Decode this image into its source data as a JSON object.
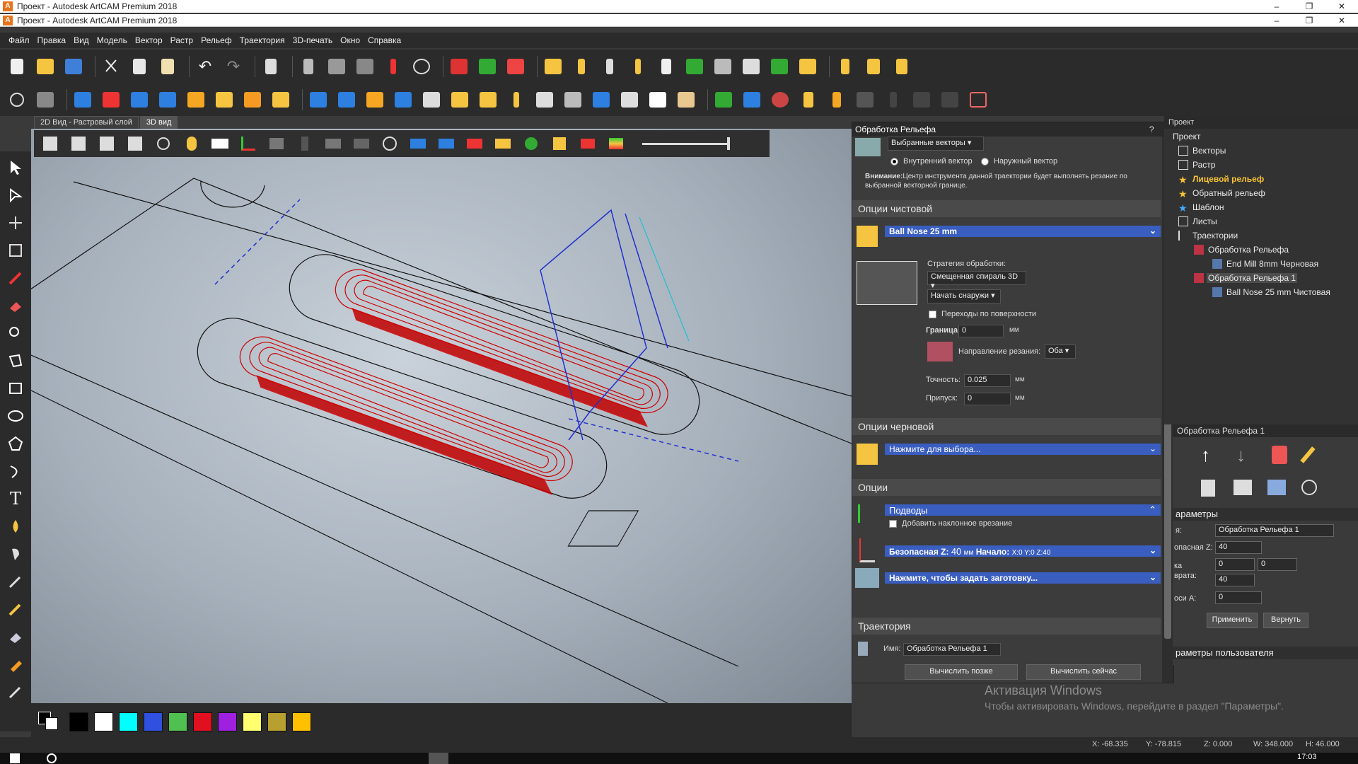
{
  "window": {
    "title_back": "Проект - Autodesk ArtCAM Premium 2018",
    "title_front": "Проект - Autodesk ArtCAM Premium 2018",
    "minimize": "–",
    "restore": "❐",
    "close": "✕"
  },
  "menu": [
    "Файл",
    "Правка",
    "Вид",
    "Модель",
    "Вектор",
    "Растр",
    "Рельеф",
    "Траектория",
    "3D-печать",
    "Окно",
    "Справка"
  ],
  "view_tabs": {
    "tab_2d": "2D Вид - Растровый слой",
    "tab_3d": "3D вид"
  },
  "palette": {
    "colors": [
      "#000000",
      "#ffffff",
      "#00ffff",
      "#3050e0",
      "#50c050",
      "#e01020",
      "#a020e0",
      "#ffff70",
      "#b8a030",
      "#ffc000"
    ]
  },
  "status": {
    "x": "X: -68.335",
    "y": "Y: -78.815",
    "z": "Z: 0.000",
    "w": "W: 348.000",
    "h": "H: 46.000",
    "clock": "17:03"
  },
  "watermark": {
    "line1": "Активация Windows",
    "line2": "Чтобы активировать Windows, перейдите в раздел \"Параметры\"."
  },
  "dialog": {
    "title": "Обработка Рельефа",
    "help": "?",
    "close": "✕",
    "vector_select": "Выбранные векторы",
    "radio_inner": "Внутренний вектор",
    "radio_outer": "Наружный вектор",
    "warning_bold": "Внимание:",
    "warning_text": "Центр инструмента данной траектории будет выполнять резание по выбранной векторной границе.",
    "finish_section": "Опции чистовой",
    "finish_tool": "Ball Nose 25 mm",
    "strategy_label": "Стратегия обработки:",
    "strategy_value": "Смещенная спираль 3D",
    "start_value": "Начать снаружи",
    "surface_transitions": "Переходы по поверхности",
    "boundary_label": "Граница",
    "boundary_value": "0",
    "boundary_unit": "мм",
    "cut_dir_label": "Направление резания:",
    "cut_dir_value": "Оба",
    "tolerance_label": "Точность:",
    "tolerance_value": "0.025",
    "tolerance_unit": "мм",
    "allowance_label": "Припуск:",
    "allowance_value": "0",
    "allowance_unit": "мм",
    "rough_section": "Опции черновой",
    "rough_tool": "Нажмите для выбора...",
    "options_section": "Опции",
    "leads_bar": "Подводы",
    "ramp_label": "Добавить наклонное врезание",
    "safez_bar_label": "Безопасная Z:",
    "safez_value": "40",
    "safez_unit": "мм",
    "start_label": "Начало:",
    "start_coords": "X:0 Y:0 Z:40",
    "material_bar": "Нажмите, чтобы задать заготовку...",
    "toolpath_section": "Траектория",
    "name_label": "Имя:",
    "name_value": "Обработка Рельефа 1",
    "btn_later": "Вычислить позже",
    "btn_now": "Вычислить сейчас"
  },
  "project": {
    "title": "Проект",
    "root": "Проект",
    "items": [
      {
        "label": "Векторы"
      },
      {
        "label": "Растр"
      },
      {
        "label": "Лицевой рельеф"
      },
      {
        "label": "Обратный рельеф"
      },
      {
        "label": "Шаблон"
      },
      {
        "label": "Листы"
      },
      {
        "label": "Траектории"
      },
      {
        "label": "Обработка Рельефа"
      },
      {
        "label": "End Mill 8mm Черновая"
      },
      {
        "label": "Обработка Рельефа 1"
      },
      {
        "label": "Ball Nose 25 mm Чистовая"
      }
    ]
  },
  "props": {
    "title": "Обработка Рельефа 1",
    "params_section": "араметры",
    "name_label": "я:",
    "name_value": "Обработка Рельефа 1",
    "safez_label": "опасная Z:",
    "safez_value": "40",
    "home_label_1": "ка",
    "home_label_2": "врата:",
    "home_x": "0",
    "home_y": "0",
    "home_z": "40",
    "axis_label": "оси A:",
    "axis_value": "0",
    "apply": "Применить",
    "revert": "Вернуть",
    "user_params": "раметры пользователя"
  }
}
